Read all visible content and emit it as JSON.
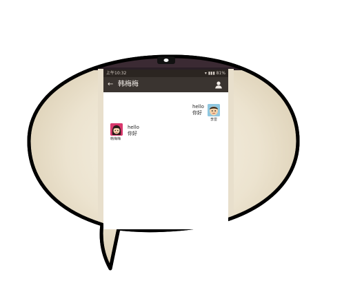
{
  "status_bar": {
    "time": "上午10:32",
    "indicators": "▾ ▮▮▮ 81%"
  },
  "title_bar": {
    "back_icon": "back-arrow-icon",
    "title": "韩梅梅",
    "contact_icon": "person-icon"
  },
  "messages": [
    {
      "sender": "李雷",
      "side": "right",
      "lines": [
        "hello",
        "你好"
      ]
    },
    {
      "sender": "韩梅梅",
      "side": "left",
      "lines": [
        "hello",
        "你好"
      ]
    }
  ],
  "colors": {
    "bubble_fill": "#efe8d8",
    "bubble_outline": "#000000",
    "phone_top": "#3b2a33",
    "title_bar": "#3a3430"
  }
}
